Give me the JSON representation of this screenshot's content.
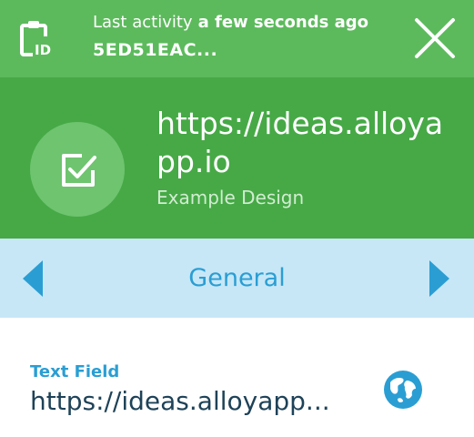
{
  "topbar": {
    "activity_label": "Last activity",
    "activity_value": "a few seconds ago",
    "record_id": "5ED51EAC...",
    "id_icon": "id-clipboard-icon",
    "close_icon": "close-icon"
  },
  "header": {
    "title": "https://ideas.alloyapp.io",
    "subtitle": "Example Design",
    "avatar_icon": "checkbox-icon"
  },
  "tabs": {
    "current": "General",
    "prev_icon": "caret-left-icon",
    "next_icon": "caret-right-icon"
  },
  "field": {
    "label": "Text Field",
    "value": "https://ideas.alloyapp...",
    "icon": "globe-icon"
  },
  "colors": {
    "topbar": "#5cba5c",
    "header": "#46a946",
    "avatar": "#6fc46f",
    "tabbar": "#c7e7f7",
    "accent_blue": "#2a9ed3",
    "value_text": "#1e4258"
  }
}
